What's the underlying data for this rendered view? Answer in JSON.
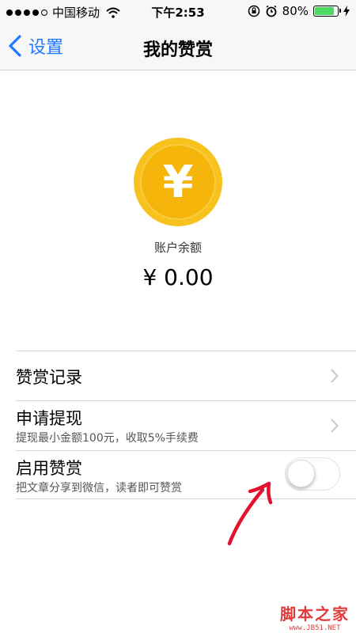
{
  "status_bar": {
    "carrier": "中国移动",
    "time": "下午2:53",
    "battery_percent": "80%",
    "battery_level": 0.8,
    "icons": [
      "signal-dots-icon",
      "wifi-icon",
      "rotation-lock-icon",
      "alarm-icon",
      "battery-icon",
      "charging-bolt-icon"
    ]
  },
  "nav": {
    "back_label": "设置",
    "title": "我的赞赏"
  },
  "balance": {
    "coin_symbol": "¥",
    "label": "账户余额",
    "amount": "¥ 0.00",
    "coin_color": "#f5b50a"
  },
  "rows": [
    {
      "label": "赞赏记录"
    },
    {
      "label": "申请提现",
      "sub": "提现最小金额100元，收取5%手续费"
    },
    {
      "label": "启用赞赏",
      "sub": "把文章分享到微信，读者即可赞赏",
      "toggle_on": false
    }
  ],
  "watermark": {
    "main": "脚本之家",
    "sub": "www.JB51.NET"
  },
  "colors": {
    "accent": "#1f78ff",
    "annotation_arrow": "#e5102e",
    "watermark": "#e23b3b"
  }
}
